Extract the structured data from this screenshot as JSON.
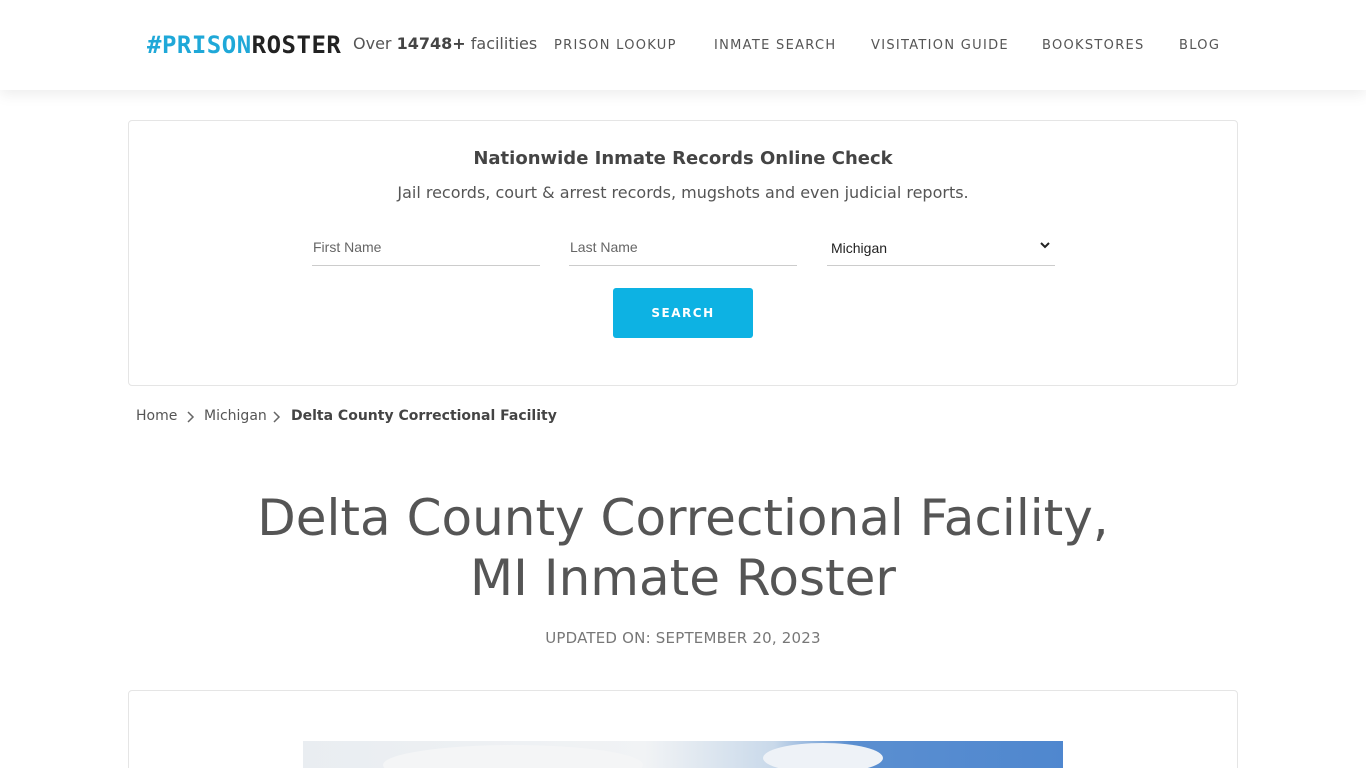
{
  "header": {
    "logo": {
      "hash": "#",
      "prison": "PRISON",
      "roster": "ROSTER"
    },
    "facility_count": {
      "prefix": "Over",
      "count": "14748+",
      "suffix": "facilities"
    },
    "nav": [
      "PRISON LOOKUP",
      "INMATE SEARCH",
      "VISITATION GUIDE",
      "BOOKSTORES",
      "BLOG"
    ]
  },
  "search": {
    "title": "Nationwide Inmate Records Online Check",
    "subtitle": "Jail records, court & arrest records, mugshots and even judicial reports.",
    "first_name_placeholder": "First Name",
    "last_name_placeholder": "Last Name",
    "state_selected": "Michigan",
    "button_label": "SEARCH"
  },
  "breadcrumb": {
    "home": "Home",
    "state": "Michigan",
    "current": "Delta County Correctional Facility"
  },
  "page": {
    "title_line1": "Delta County Correctional Facility,",
    "title_line2": "MI Inmate Roster",
    "updated": "UPDATED ON: SEPTEMBER 20, 2023"
  },
  "colors": {
    "accent": "#0db2e3",
    "logo_blue": "#1fa8d8"
  }
}
